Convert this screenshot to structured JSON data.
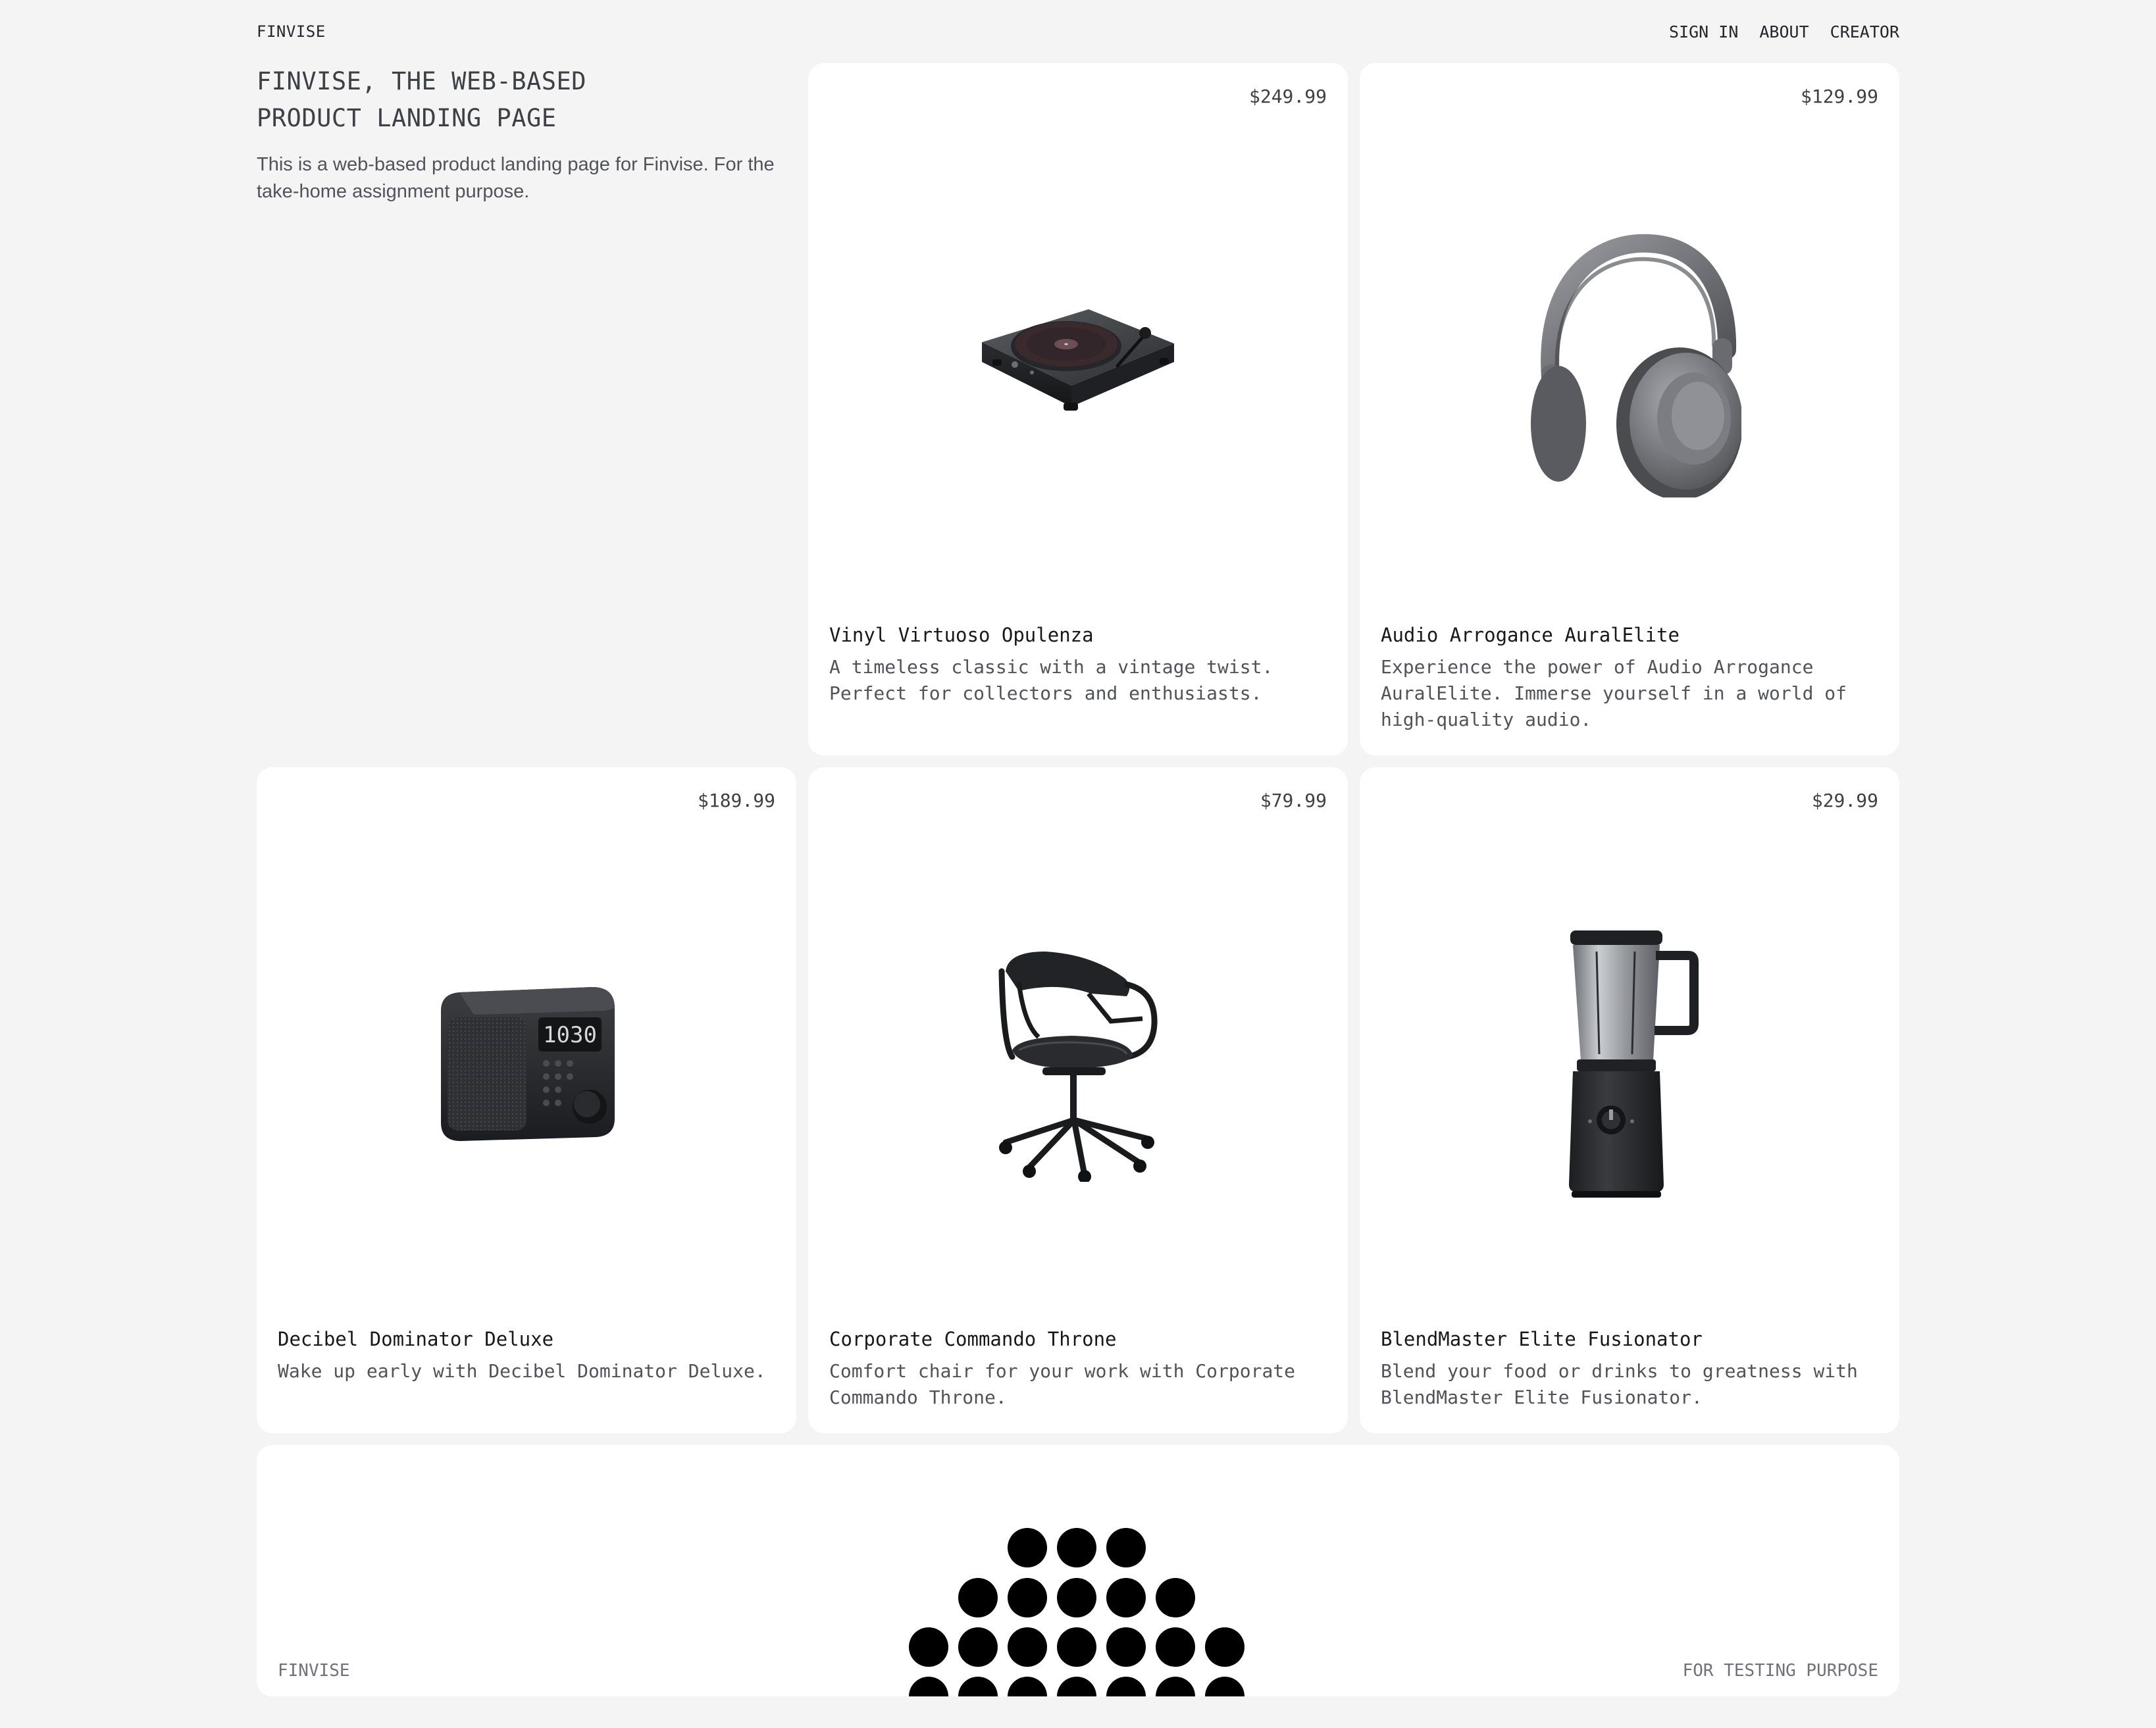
{
  "header": {
    "brand": "FINVISE",
    "nav": [
      {
        "label": "SIGN IN"
      },
      {
        "label": "ABOUT"
      },
      {
        "label": "CREATOR"
      }
    ]
  },
  "intro": {
    "title_line1": "FINVISE, THE WEB-BASED",
    "title_line2": "PRODUCT LANDING PAGE",
    "description": "This is a web-based product landing page for Finvise. For the take-home assignment purpose."
  },
  "products": [
    {
      "price": "$249.99",
      "name": "Vinyl Virtuoso Opulenza",
      "description": "A timeless classic with a vintage twist. Perfect for collectors and enthusiasts.",
      "icon": "turntable-image"
    },
    {
      "price": "$129.99",
      "name": "Audio Arrogance AuralElite",
      "description": "Experience the power of Audio Arrogance AuralElite. Immerse yourself in a world of high-quality audio.",
      "icon": "headphones-image"
    },
    {
      "price": "$189.99",
      "name": "Decibel Dominator Deluxe",
      "description": "Wake up early with Decibel Dominator Deluxe.",
      "icon": "clock-radio-image",
      "clock_display": "1030"
    },
    {
      "price": "$79.99",
      "name": "Corporate Commando Throne",
      "description": "Comfort chair for your work with Corporate Commando Throne.",
      "icon": "office-chair-image"
    },
    {
      "price": "$29.99",
      "name": "BlendMaster Elite Fusionator",
      "description": "Blend your food or drinks to greatness with BlendMaster Elite Fusionator.",
      "icon": "blender-image"
    }
  ],
  "footer": {
    "left": "FINVISE",
    "right": "FOR TESTING PURPOSE",
    "graphic": "dot-pattern-logo"
  },
  "colors": {
    "page_bg": "#f4f4f5",
    "card_bg": "#ffffff",
    "text_primary": "#18181b",
    "text_muted": "#52525b",
    "footer_text": "#71717a"
  }
}
